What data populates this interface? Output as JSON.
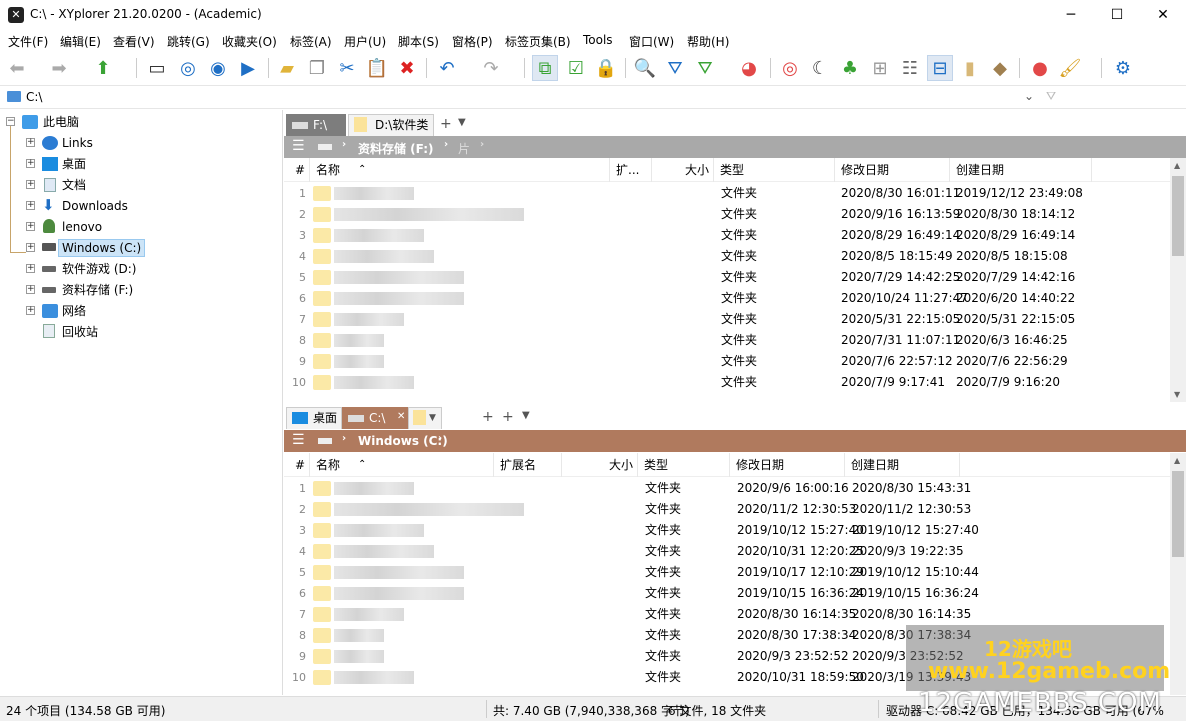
{
  "window": {
    "title": "C:\\ - XYplorer 21.20.0200 - (Academic)",
    "minimize": "─",
    "maximize": "☐",
    "close": "✕"
  },
  "menu": [
    "文件(F)",
    "编辑(E)",
    "查看(V)",
    "跳转(G)",
    "收藏夹(O)",
    "标签(A)",
    "用户(U)",
    "脚本(S)",
    "窗格(P)",
    "标签页集(B)",
    "Tools",
    "窗口(W)",
    "帮助(H)"
  ],
  "toolbar_icons": [
    "back-icon",
    "forward-icon",
    "up-icon",
    "computer-icon",
    "target-icon",
    "search-circle-icon",
    "play-circle-icon",
    "new-folder-icon",
    "copy-icon",
    "cut-icon",
    "paste-icon",
    "delete-icon",
    "undo-icon",
    "redo-icon",
    "sync-icon",
    "checkbox-icon",
    "lock-icon",
    "find-icon",
    "filter-icon",
    "visual-filter-icon",
    "pie-icon",
    "spiral-icon",
    "moon-icon",
    "tree-icon",
    "grid-icon",
    "details-icon",
    "dual-pane-icon",
    "preview-icon",
    "tag-icon",
    "color-icon",
    "brush-icon",
    "settings-icon"
  ],
  "address": {
    "path": "C:\\"
  },
  "tree": {
    "root": "此电脑",
    "items": [
      "Links",
      "桌面",
      "文档",
      "Downloads",
      "lenovo",
      "Windows (C:)",
      "软件游戏 (D:)",
      "资料存储 (F:)",
      "网络",
      "回收站"
    ],
    "selected": "Windows (C:)"
  },
  "pane1": {
    "tabs": [
      "F:\\",
      "D:\\软件类"
    ],
    "breadcrumb": [
      "资料存储 (F:)",
      "片"
    ],
    "accent": "#a9a9a9",
    "columns": [
      "#",
      "名称",
      "扩...",
      "大小",
      "类型",
      "修改日期",
      "创建日期"
    ],
    "rows": [
      {
        "n": "1",
        "type": "文件夹",
        "modified": "2020/8/30 16:01:11",
        "created": "2019/12/12 23:49:08"
      },
      {
        "n": "2",
        "type": "文件夹",
        "modified": "2020/9/16 16:13:59",
        "created": "2020/8/30 18:14:12"
      },
      {
        "n": "3",
        "type": "文件夹",
        "modified": "2020/8/29 16:49:14",
        "created": "2020/8/29 16:49:14"
      },
      {
        "n": "4",
        "type": "文件夹",
        "modified": "2020/8/5 18:15:49",
        "created": "2020/8/5 18:15:08"
      },
      {
        "n": "5",
        "type": "文件夹",
        "modified": "2020/7/29 14:42:25",
        "created": "2020/7/29 14:42:16"
      },
      {
        "n": "6",
        "type": "文件夹",
        "modified": "2020/10/24 11:27:47",
        "created": "2020/6/20 14:40:22"
      },
      {
        "n": "7",
        "type": "文件夹",
        "modified": "2020/5/31 22:15:05",
        "created": "2020/5/31 22:15:05"
      },
      {
        "n": "8",
        "type": "文件夹",
        "modified": "2020/7/31 11:07:11",
        "created": "2020/6/3 16:46:25"
      },
      {
        "n": "9",
        "type": "文件夹",
        "modified": "2020/7/6 22:57:12",
        "created": "2020/7/6 22:56:29"
      },
      {
        "n": "10",
        "type": "文件夹",
        "modified": "2020/7/9 9:17:41",
        "created": "2020/7/9 9:16:20"
      }
    ]
  },
  "pane2": {
    "tabs": [
      "桌面",
      "C:\\"
    ],
    "breadcrumb": [
      "Windows (C:)"
    ],
    "accent": "#b07a5e",
    "columns": [
      "#",
      "名称",
      "扩展名",
      "大小",
      "类型",
      "修改日期",
      "创建日期"
    ],
    "rows": [
      {
        "n": "1",
        "type": "文件夹",
        "modified": "2020/9/6 16:00:16",
        "created": "2020/8/30 15:43:31"
      },
      {
        "n": "2",
        "type": "文件夹",
        "modified": "2020/11/2 12:30:53",
        "created": "2020/11/2 12:30:53"
      },
      {
        "n": "3",
        "type": "文件夹",
        "modified": "2019/10/12 15:27:40",
        "created": "2019/10/12 15:27:40"
      },
      {
        "n": "4",
        "type": "文件夹",
        "modified": "2020/10/31 12:20:25",
        "created": "2020/9/3 19:22:35"
      },
      {
        "n": "5",
        "type": "文件夹",
        "modified": "2019/10/17 12:10:29",
        "created": "2019/10/12 15:10:44"
      },
      {
        "n": "6",
        "type": "文件夹",
        "modified": "2019/10/15 16:36:24",
        "created": "2019/10/15 16:36:24"
      },
      {
        "n": "7",
        "type": "文件夹",
        "modified": "2020/8/30 16:14:35",
        "created": "2020/8/30 16:14:35"
      },
      {
        "n": "8",
        "type": "文件夹",
        "modified": "2020/8/30 17:38:34",
        "created": "2020/8/30 17:38:34"
      },
      {
        "n": "9",
        "type": "文件夹",
        "modified": "2020/9/3 23:52:52",
        "created": "2020/9/3 23:52:52"
      },
      {
        "n": "10",
        "type": "文件夹",
        "modified": "2020/10/31 18:59:50",
        "created": "2020/3/19 13:39:43"
      }
    ]
  },
  "status": {
    "items": "24 个项目 (134.58 GB 可用)",
    "total": "共: 7.40 GB (7,940,338,368 字节)",
    "counts": "6 文件, 18 文件夹",
    "drive": "驱动器 C: 68.42 GB 已用，134.58 GB 可用 (67%)"
  },
  "watermark": {
    "line1": "12游戏吧",
    "line2": "www.12gameb.com",
    "line3": "12GAMEBBS.COM"
  }
}
